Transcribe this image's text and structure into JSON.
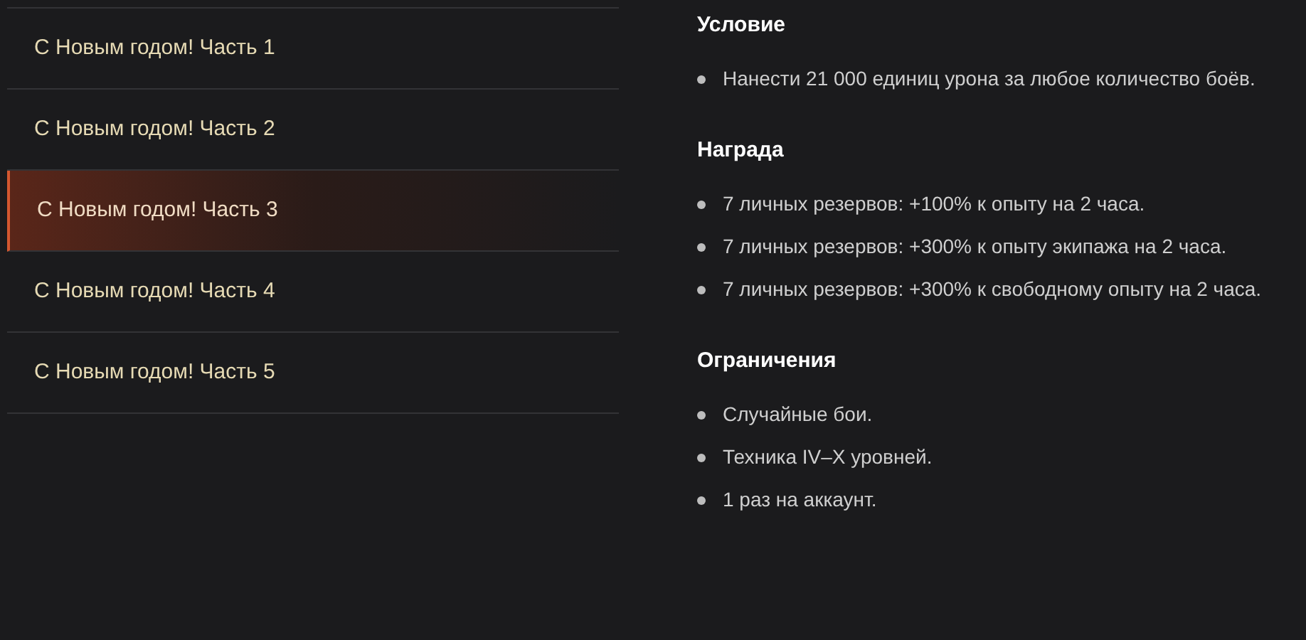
{
  "missions": [
    {
      "label": "С Новым годом! Часть 1",
      "selected": false
    },
    {
      "label": "С Новым годом! Часть 2",
      "selected": false
    },
    {
      "label": "С Новым годом! Часть 3",
      "selected": true
    },
    {
      "label": "С Новым годом! Часть 4",
      "selected": false
    },
    {
      "label": "С Новым годом! Часть 5",
      "selected": false
    }
  ],
  "sections": [
    {
      "heading": "Условие",
      "items": [
        "Нанести 21 000 единиц урона за любое количество боёв."
      ]
    },
    {
      "heading": "Награда",
      "items": [
        "7 личных резервов: +100% к опыту на 2 часа.",
        "7 личных резервов: +300% к опыту экипажа на 2 часа.",
        "7 личных резервов: +300% к свободному опыту на 2 часа."
      ]
    },
    {
      "heading": "Ограничения",
      "items": [
        "Случайные бои.",
        "Техника IV–X уровней.",
        "1 раз на аккаунт."
      ]
    }
  ]
}
